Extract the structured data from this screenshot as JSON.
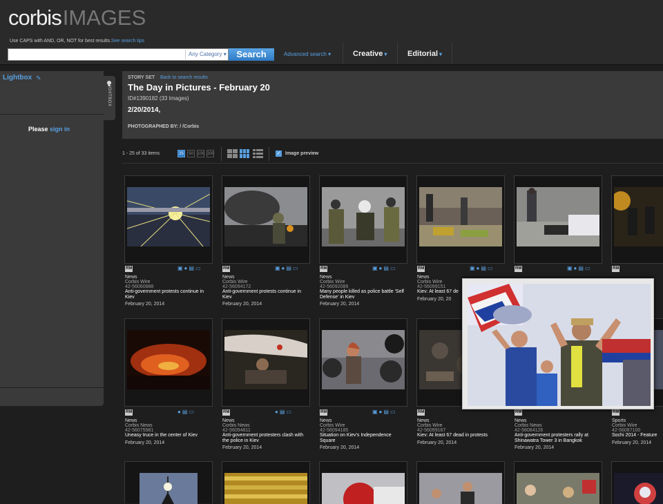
{
  "header": {
    "logo_brand": "corbis",
    "logo_images": "IMAGES",
    "tip_text": "Use CAPS with AND, OR, NOT for best results.",
    "tip_link": "See search tips",
    "search_placeholder": "",
    "category": "Any Category",
    "search_label": "Search",
    "advanced_label": "Advanced search",
    "nav_creative": "Creative",
    "nav_editorial": "Editorial",
    "accent": "#5aa0e0"
  },
  "sidebar": {
    "title": "Lightbox",
    "please": "Please",
    "sign_in": "sign in",
    "tab_label": "LIGHTBOX"
  },
  "story": {
    "set_label": "STORY SET",
    "back_link": "Back to search results",
    "title": "The Day in Pictures - February 20",
    "id": "ID#1390182 (33 Images)",
    "date": "2/20/2014,",
    "photographed_by": "PHOTOGRAPHED BY:  /  /Corbis"
  },
  "toolbar": {
    "count": "1 - 25 of 33 items",
    "page_sizes": [
      "25",
      "50",
      "100",
      "200"
    ],
    "preview_label": "Image preview"
  },
  "tiles": [
    {
      "rm": "RM",
      "type": "News",
      "source": "Corbis Wire",
      "id": "42-56060888",
      "caption": "Anti-government protests continue in Kiev",
      "date": "February 20, 2014"
    },
    {
      "rm": "RM",
      "type": "News",
      "source": "Corbis Wire",
      "id": "42-56094172",
      "caption": "Anti-government protests continue in Kiev",
      "date": "February 20, 2014"
    },
    {
      "rm": "RM",
      "type": "News",
      "source": "Corbis Wire",
      "id": "42-56092089",
      "caption": "Many people killed as police battle 'Self Defense' in Kiev",
      "date": "February 20, 2014"
    },
    {
      "rm": "RM",
      "type": "News",
      "source": "Corbis Wire",
      "id": "42-56099151",
      "caption": "Kiev: At least 67 de",
      "date": "February 20, 20"
    },
    {
      "rm": "RM",
      "type": "",
      "source": "",
      "id": "",
      "caption": "",
      "date": ""
    },
    {
      "rm": "RM",
      "type": "",
      "source": "",
      "id": "",
      "caption": "",
      "date": ""
    },
    {
      "rm": "RM",
      "type": "News",
      "source": "Corbis News",
      "id": "42-56075981",
      "caption": "Uneasy truce in the center of Kiev",
      "date": "February 20, 2014"
    },
    {
      "rm": "RM",
      "type": "News",
      "source": "Corbis News",
      "id": "42-56094811",
      "caption": "Anti-government protesters clash with the police in Kiev",
      "date": "February 20, 2014"
    },
    {
      "rm": "RM",
      "type": "News",
      "source": "Corbis Wire",
      "id": "42-56094185",
      "caption": "Situation on Kiev's Independence Square",
      "date": "February 20, 2014"
    },
    {
      "rm": "RM",
      "type": "News",
      "source": "Corbis Wire",
      "id": "42-56099167",
      "caption": "Kiev: At least 67 dead in protests",
      "date": "February 20, 2014"
    },
    {
      "rm": "RM",
      "type": "News",
      "source": "Corbis News",
      "id": "42-56084126",
      "caption": "Anti-government protesters rally at Shinawatra Tower 3 in Bangkok",
      "date": "February 20, 2014"
    },
    {
      "rm": "RM",
      "type": "Sports",
      "source": "Corbis Wire",
      "id": "42-56087100",
      "caption": "Sochi 2014 - Feature",
      "date": "February 20, 2014"
    }
  ]
}
